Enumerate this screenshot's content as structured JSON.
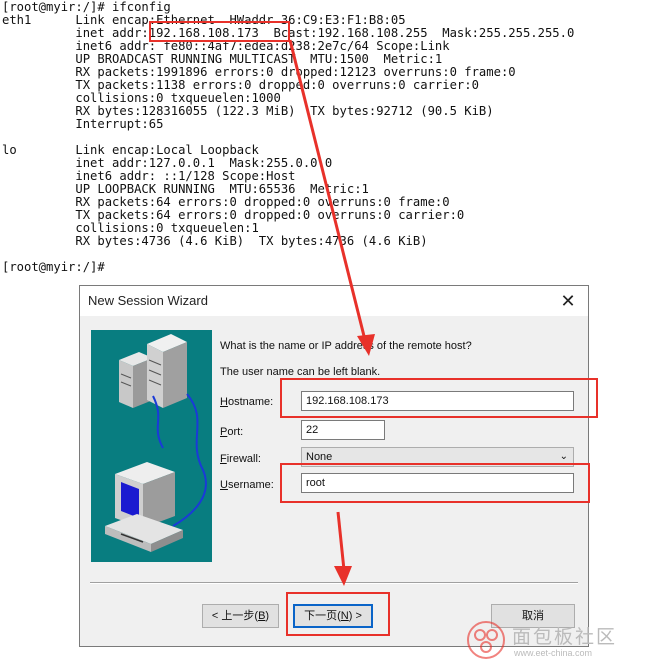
{
  "terminal": {
    "lines": [
      "[root@myir:/]# ifconfig",
      "eth1      Link encap:Ethernet  HWaddr 36:C9:E3:F1:B8:05",
      "          inet addr:192.168.108.173  Bcast:192.168.108.255  Mask:255.255.255.0",
      "          inet6 addr: fe80::4af7:edea:d238:2e7c/64 Scope:Link",
      "          UP BROADCAST RUNNING MULTICAST  MTU:1500  Metric:1",
      "          RX packets:1991896 errors:0 dropped:12123 overruns:0 frame:0",
      "          TX packets:1138 errors:0 dropped:0 overruns:0 carrier:0",
      "          collisions:0 txqueuelen:1000",
      "          RX bytes:128316055 (122.3 MiB)  TX bytes:92712 (90.5 KiB)",
      "          Interrupt:65",
      "",
      "lo        Link encap:Local Loopback",
      "          inet addr:127.0.0.1  Mask:255.0.0.0",
      "          inet6 addr: ::1/128 Scope:Host",
      "          UP LOOPBACK RUNNING  MTU:65536  Metric:1",
      "          RX packets:64 errors:0 dropped:0 overruns:0 frame:0",
      "          TX packets:64 errors:0 dropped:0 overruns:0 carrier:0",
      "          collisions:0 txqueuelen:1",
      "          RX bytes:4736 (4.6 KiB)  TX bytes:4736 (4.6 KiB)",
      "",
      "[root@myir:/]#"
    ]
  },
  "dialog": {
    "title": "New Session Wizard",
    "question": "What is the name or IP address of the remote host?",
    "note": "The user name can be left blank.",
    "hostname_label": "ostname:",
    "hostname_key": "H",
    "hostname_value": "192.168.108.173",
    "port_label": "ort:",
    "port_key": "P",
    "port_value": "22",
    "firewall_label": "irewall:",
    "firewall_key": "F",
    "firewall_value": "None",
    "username_label": "sername:",
    "username_key": "U",
    "username_value": "root",
    "back_label_pre": "< 上一步(",
    "back_key": "B",
    "back_label_post": ")",
    "next_label_pre": "下一页(",
    "next_key": "N",
    "next_label_post": ") >",
    "cancel_label": "取消"
  },
  "watermark": {
    "text": "面包板社区",
    "url": "www.eet-china.com"
  },
  "colors": {
    "highlight": "#e8312a",
    "art_background": "#087d80"
  }
}
